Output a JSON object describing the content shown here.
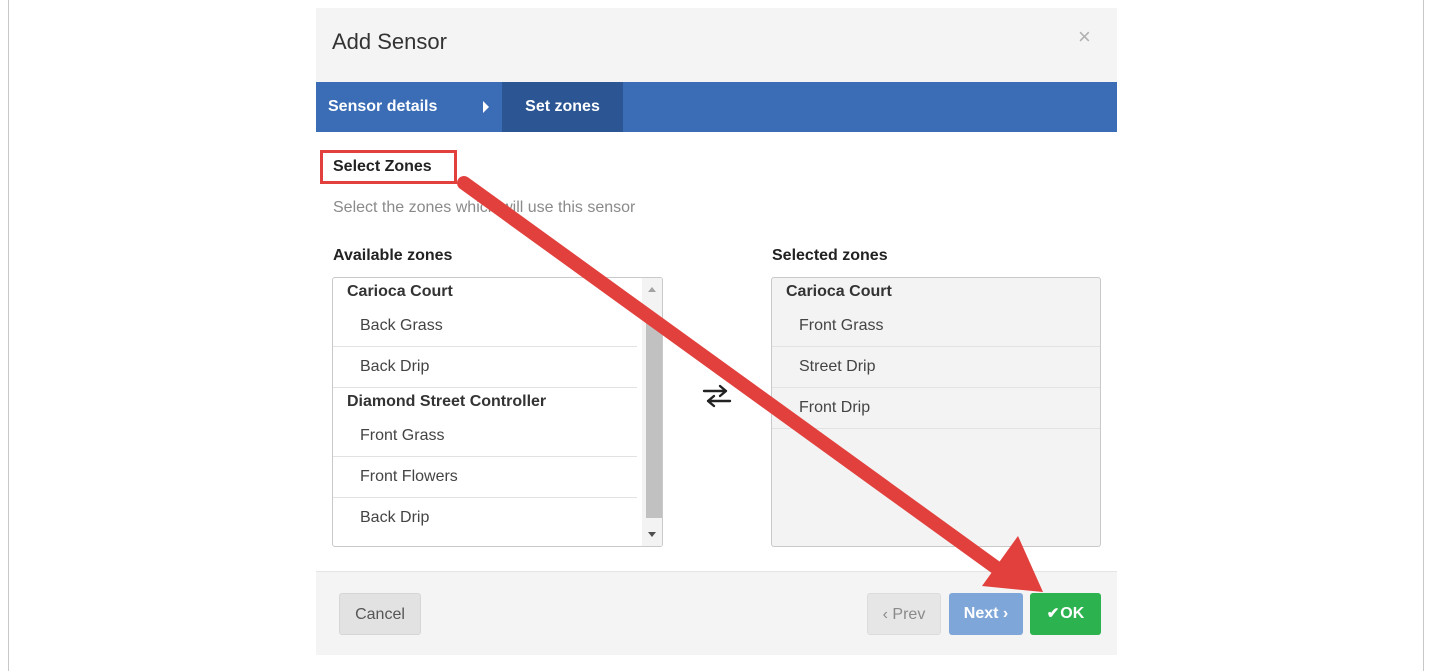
{
  "modal": {
    "title": "Add Sensor",
    "close_symbol": "×"
  },
  "wizard": {
    "steps": [
      {
        "label": "Sensor details",
        "active": false
      },
      {
        "label": "Set zones",
        "active": true
      }
    ]
  },
  "section": {
    "title": "Select Zones",
    "description": "Select the zones which will use this sensor"
  },
  "available": {
    "label": "Available zones",
    "groups": [
      {
        "name": "Carioca Court",
        "zones": [
          "Back Grass",
          "Back Drip"
        ]
      },
      {
        "name": "Diamond Street Controller",
        "zones": [
          "Front Grass",
          "Front Flowers",
          "Back Drip"
        ]
      }
    ]
  },
  "selected": {
    "label": "Selected zones",
    "groups": [
      {
        "name": "Carioca Court",
        "zones": [
          "Front Grass",
          "Street Drip",
          "Front Drip"
        ]
      }
    ]
  },
  "footer": {
    "cancel_label": "Cancel",
    "prev_label": "‹ Prev",
    "next_label": "Next ›",
    "ok_check": "✔",
    "ok_label": "OK"
  },
  "icons": {
    "transfer": "transfer-arrows-icon",
    "close": "close-icon",
    "step_arrow": "caret-right-icon",
    "check": "check-icon"
  },
  "colors": {
    "wizard_bar": "#3a6db5",
    "wizard_active": "#2b5593",
    "ok_button": "#2cb24e",
    "next_button": "#7fa6d8",
    "annotation": "#e2403d"
  }
}
